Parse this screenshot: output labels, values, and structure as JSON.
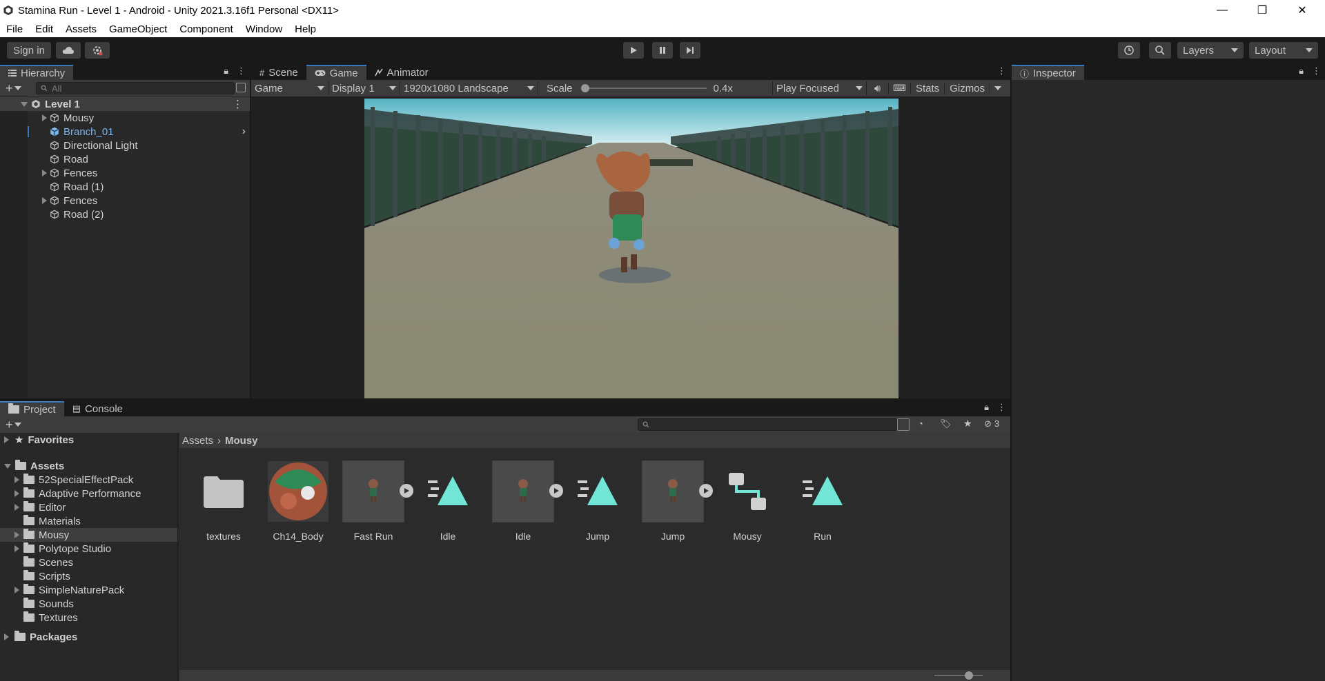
{
  "window": {
    "title": "Stamina Run - Level 1 - Android - Unity 2021.3.16f1 Personal <DX11>",
    "minimize": "—",
    "maximize": "❐",
    "close": "✕"
  },
  "menu": [
    "File",
    "Edit",
    "Assets",
    "GameObject",
    "Component",
    "Window",
    "Help"
  ],
  "toolbar": {
    "sign_in": "Sign in",
    "layers": "Layers",
    "layout": "Layout"
  },
  "hierarchy": {
    "tab": "Hierarchy",
    "search_placeholder": "All",
    "scene": "Level 1",
    "items": [
      {
        "label": "Mousy",
        "expandable": true,
        "selected": false
      },
      {
        "label": "Branch_01",
        "expandable": false,
        "selected": true
      },
      {
        "label": "Directional Light",
        "expandable": false,
        "selected": false
      },
      {
        "label": "Road",
        "expandable": false,
        "selected": false
      },
      {
        "label": "Fences",
        "expandable": true,
        "selected": false
      },
      {
        "label": "Road (1)",
        "expandable": false,
        "selected": false
      },
      {
        "label": "Fences",
        "expandable": true,
        "selected": false
      },
      {
        "label": "Road (2)",
        "expandable": false,
        "selected": false
      }
    ]
  },
  "center": {
    "tabs": [
      "Scene",
      "Game",
      "Animator"
    ],
    "active_tab": "Game",
    "game_dropdown": "Game",
    "display": "Display 1",
    "resolution": "1920x1080 Landscape",
    "scale_label": "Scale",
    "scale_value": "0.4x",
    "scale_fraction": 0.0,
    "play_mode": "Play Focused",
    "stats": "Stats",
    "gizmos": "Gizmos"
  },
  "inspector": {
    "tab": "Inspector"
  },
  "project": {
    "tabs": [
      "Project",
      "Console"
    ],
    "hidden_count": "3",
    "breadcrumb": [
      "Assets",
      "Mousy"
    ],
    "favorites": "Favorites",
    "assets_root": "Assets",
    "packages": "Packages",
    "folders": [
      {
        "label": "52SpecialEffectPack",
        "expandable": true,
        "selected": false
      },
      {
        "label": "Adaptive Performance",
        "expandable": true,
        "selected": false
      },
      {
        "label": "Editor",
        "expandable": true,
        "selected": false
      },
      {
        "label": "Materials",
        "expandable": false,
        "selected": false
      },
      {
        "label": "Mousy",
        "expandable": true,
        "selected": true
      },
      {
        "label": "Polytope Studio",
        "expandable": true,
        "selected": false
      },
      {
        "label": "Scenes",
        "expandable": false,
        "selected": false
      },
      {
        "label": "Scripts",
        "expandable": false,
        "selected": false
      },
      {
        "label": "SimpleNaturePack",
        "expandable": true,
        "selected": false
      },
      {
        "label": "Sounds",
        "expandable": false,
        "selected": false
      },
      {
        "label": "Textures",
        "expandable": false,
        "selected": false
      }
    ],
    "assets": [
      {
        "label": "textures",
        "kind": "folder"
      },
      {
        "label": "Ch14_Body",
        "kind": "material"
      },
      {
        "label": "Fast Run",
        "kind": "model"
      },
      {
        "label": "Idle",
        "kind": "anim"
      },
      {
        "label": "Idle",
        "kind": "model"
      },
      {
        "label": "Jump",
        "kind": "anim"
      },
      {
        "label": "Jump",
        "kind": "model"
      },
      {
        "label": "Mousy",
        "kind": "controller"
      },
      {
        "label": "Run",
        "kind": "anim"
      }
    ],
    "zoom_fraction": 0.75
  },
  "colors": {
    "accent": "#3a79bb",
    "selected_text": "#7ab6f0",
    "anim_teal": "#72e6d6",
    "panel_bg": "#282828",
    "toolbar_bg": "#191919"
  }
}
